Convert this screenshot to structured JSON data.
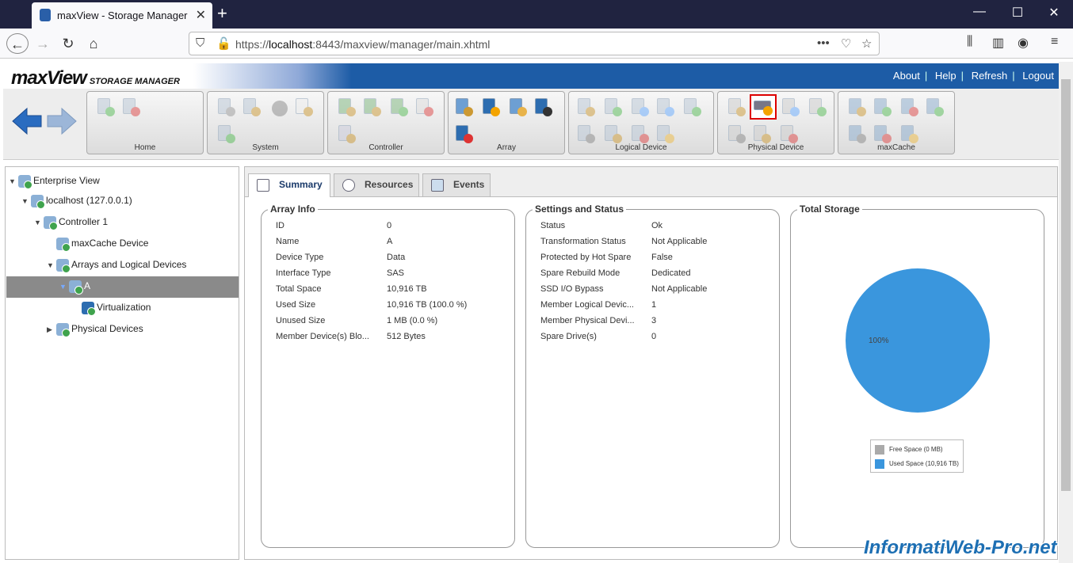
{
  "browser": {
    "tab_title": "maxView - Storage Manager",
    "url_prefix": "https://",
    "url_host": "localhost",
    "url_rest": ":8443/maxview/manager/main.xhtml"
  },
  "app": {
    "logo": "maxView",
    "logo_sub": "STORAGE MANAGER",
    "links": {
      "about": "About",
      "help": "Help",
      "refresh": "Refresh",
      "logout": "Logout"
    },
    "toolbar_groups": [
      "Home",
      "System",
      "Controller",
      "Array",
      "Logical Device",
      "Physical Device",
      "maxCache"
    ]
  },
  "tree": {
    "enterprise": "Enterprise View",
    "host": "localhost (127.0.0.1)",
    "controller": "Controller 1",
    "maxcache": "maxCache Device",
    "arrays": "Arrays and Logical Devices",
    "array_a": "A",
    "virtualization": "Virtualization",
    "physical": "Physical Devices"
  },
  "tabs": {
    "summary": "Summary",
    "resources": "Resources",
    "events": "Events"
  },
  "array_info": {
    "title": "Array Info",
    "rows": [
      {
        "k": "ID",
        "v": "0"
      },
      {
        "k": "Name",
        "v": "A"
      },
      {
        "k": "Device Type",
        "v": "Data"
      },
      {
        "k": "Interface Type",
        "v": "SAS"
      },
      {
        "k": "Total Space",
        "v": "10,916 TB"
      },
      {
        "k": "Used Size",
        "v": "10,916 TB (100.0 %)"
      },
      {
        "k": "Unused Size",
        "v": "1 MB (0.0 %)"
      },
      {
        "k": "Member Device(s) Blo...",
        "v": "512 Bytes"
      }
    ]
  },
  "settings": {
    "title": "Settings and Status",
    "rows": [
      {
        "k": "Status",
        "v": "Ok"
      },
      {
        "k": "Transformation Status",
        "v": "Not Applicable"
      },
      {
        "k": "Protected by Hot Spare",
        "v": "False"
      },
      {
        "k": "Spare Rebuild Mode",
        "v": "Dedicated"
      },
      {
        "k": "SSD I/O Bypass",
        "v": "Not Applicable"
      },
      {
        "k": "Member Logical Devic...",
        "v": "1"
      },
      {
        "k": "Member Physical Devi...",
        "v": "3"
      },
      {
        "k": "Spare Drive(s)",
        "v": "0"
      }
    ]
  },
  "storage": {
    "title": "Total Storage",
    "pie_label": "100%",
    "legend_free": "Free Space (0 MB)",
    "legend_used": "Used Space (10,916 TB)",
    "used_fraction": 1.0,
    "color_used": "#3a96dd",
    "color_free": "#aaaaaa"
  },
  "watermark": "InformatiWeb-Pro.net"
}
